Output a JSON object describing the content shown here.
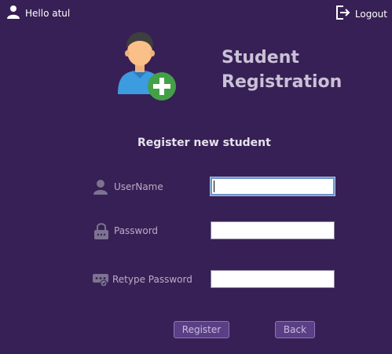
{
  "topbar": {
    "greeting": "Hello atul",
    "logout_label": "Logout"
  },
  "header": {
    "title_line1": "Student",
    "title_line2": "Registration",
    "subtitle": "Register new student"
  },
  "form": {
    "username_label": "UserName",
    "password_label": "Password",
    "retype_label": "Retype Password",
    "username_value": "",
    "password_value": "",
    "retype_value": ""
  },
  "buttons": {
    "register_label": "Register",
    "back_label": "Back"
  },
  "colors": {
    "background": "#372055",
    "button": "#5a3f86",
    "title": "#c9c1d6"
  },
  "icons": {
    "user": "user-icon",
    "logout": "logout-icon",
    "add_student": "add-student-icon",
    "lock": "lock-icon",
    "password_key": "password-key-icon"
  }
}
